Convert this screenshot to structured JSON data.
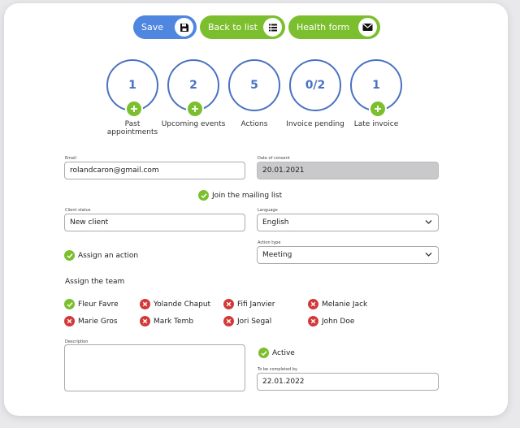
{
  "toolbar": {
    "save_label": "Save",
    "back_label": "Back to list",
    "health_label": "Health form"
  },
  "stats": [
    {
      "value": "1",
      "label": "Past appointments",
      "has_plus": true
    },
    {
      "value": "2",
      "label": "Upcoming events",
      "has_plus": true
    },
    {
      "value": "5",
      "label": "Actions",
      "has_plus": false
    },
    {
      "value": "0/2",
      "label": "Invoice pending",
      "has_plus": false
    },
    {
      "value": "1",
      "label": "Late invoice",
      "has_plus": true
    }
  ],
  "form": {
    "email_label": "Email",
    "email_value": "rolandcaron@gmail.com",
    "consent_label": "Date of consent",
    "consent_value": "20.01.2021",
    "mailing_label": "Join the mailing list",
    "status_label": "Client status",
    "status_value": "New client",
    "language_label": "Language",
    "language_value": "English",
    "assign_action_label": "Assign an action",
    "action_type_label": "Action type",
    "action_type_value": "Meeting",
    "team_title": "Assign the team",
    "team": [
      {
        "name": "Fleur Favre",
        "selected": true
      },
      {
        "name": "Yolande Chaput",
        "selected": false
      },
      {
        "name": "Fifi Janvier",
        "selected": false
      },
      {
        "name": "Melanie Jack",
        "selected": false
      },
      {
        "name": "Marie Gros",
        "selected": false
      },
      {
        "name": "Mark Temb",
        "selected": false
      },
      {
        "name": "Jori Segal",
        "selected": false
      },
      {
        "name": "John Doe",
        "selected": false
      }
    ],
    "description_label": "Description",
    "active_label": "Active",
    "complete_label": "To be completed by",
    "complete_value": "22.01.2022"
  },
  "colors": {
    "primary_blue": "#4f86e0",
    "accent_green": "#7bbf2e",
    "stat_blue": "#4a72c2",
    "reject_red": "#d23a3a"
  },
  "icons": {
    "save": "floppy-icon",
    "back": "list-icon",
    "health": "envelope-icon"
  }
}
